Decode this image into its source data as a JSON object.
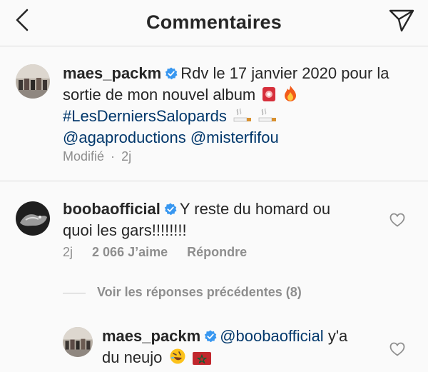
{
  "header": {
    "title": "Commentaires",
    "back_icon": "chevron-left-icon",
    "send_icon": "paper-plane-icon"
  },
  "post": {
    "username": "maes_packm",
    "text_line1": "Rdv le 17 janvier 2020 pour la",
    "text_line2": "sortie de mon nouvel album",
    "hashtag": "#LesDerniersSalopards",
    "mention1": "@agaproductions",
    "mention2": "@misterfifou",
    "edited": "Modifié",
    "time": "2j"
  },
  "comment": {
    "username": "boobaofficial",
    "text_line1": "Y reste du homard ou",
    "text_line2": "quoi les gars!!!!!!!!",
    "time": "2j",
    "likes": "2 066 J’aime",
    "reply_label": "Répondre"
  },
  "view_replies": "Voir les réponses précédentes (8)",
  "reply": {
    "username": "maes_packm",
    "mention": "@boobaofficial",
    "text_tail": "y'a",
    "text_line2": "du neujo"
  },
  "colors": {
    "link": "#00376b",
    "verified": "#3897f0",
    "muted": "#8e8e8e"
  }
}
